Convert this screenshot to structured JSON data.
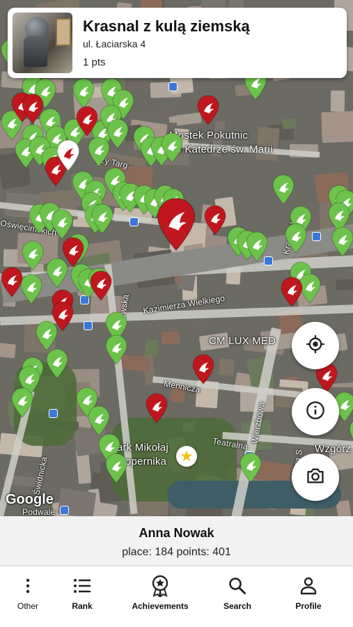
{
  "card": {
    "title": "Krasnal z kulą ziemską",
    "address": "ul. Łaciarska 4",
    "points": "1 pts"
  },
  "map": {
    "labels": {
      "mostek": "Mostek Pokutnic",
      "katedra": "w Katedrze św. Marii",
      "targ": "rzy Targ",
      "oswiecimskich": "Oświęcimskich",
      "kazimierza": "Kazimierza Wielkiego",
      "szewska": "Szewska",
      "krawiecka": "Krawiecka",
      "luxmed": "CM LUX MED",
      "mennicza": "Mennicza",
      "wierzbowa": "Wierzbowa",
      "teatralna": "Teatralna",
      "piotra": "Piotra S",
      "swidnicka": "Świdnicka",
      "park1": "ark Mikołaj",
      "park2": "opernika",
      "wzgorz": "Wzgórz",
      "podwale": "Podwale"
    },
    "google": "Google",
    "colors": {
      "found": "#6cc24a",
      "notfound": "#c0161d",
      "selected": "#ffffff",
      "star": "#f2c40b"
    }
  },
  "fabs": {
    "locate_icon": "my-location-icon",
    "info_icon": "info-icon",
    "camera_icon": "camera-icon"
  },
  "user": {
    "name": "Anna Nowak",
    "stats": "place: 184 points: 401"
  },
  "nav": {
    "items": [
      {
        "label": "Other",
        "icon": "more-vertical-icon"
      },
      {
        "label": "Rank",
        "icon": "list-icon"
      },
      {
        "label": "Achievements",
        "icon": "award-icon"
      },
      {
        "label": "Search",
        "icon": "search-icon"
      },
      {
        "label": "Profile",
        "icon": "person-icon"
      }
    ]
  }
}
